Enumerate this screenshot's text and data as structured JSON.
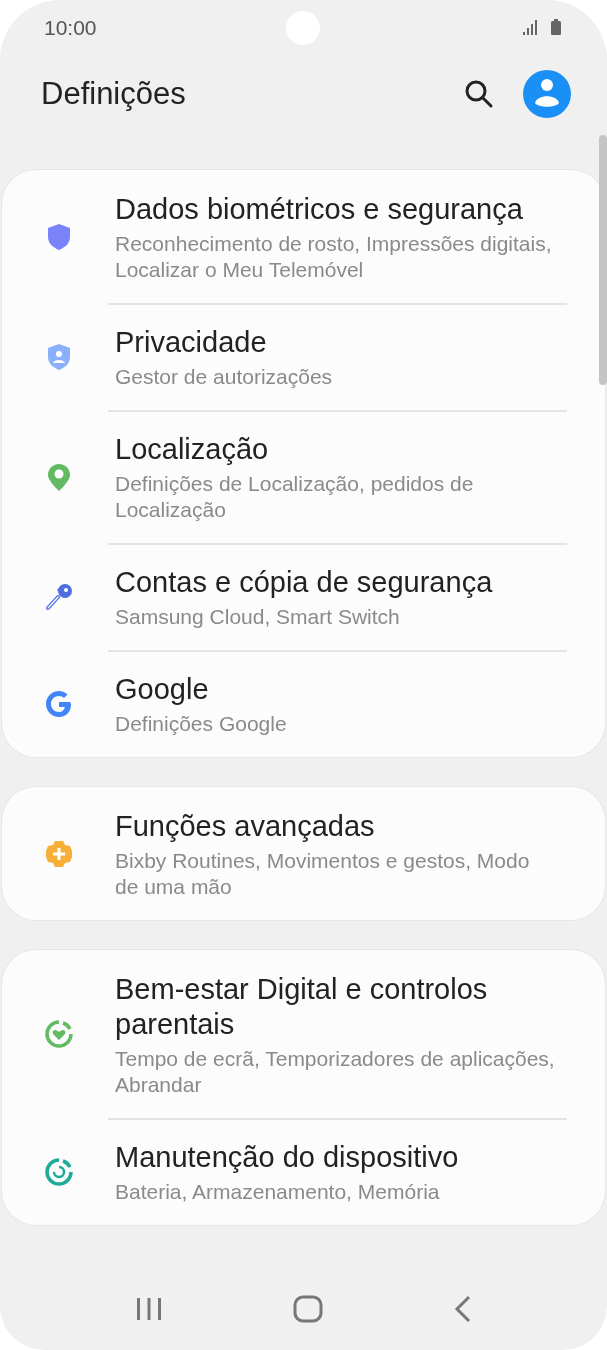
{
  "status_bar": {
    "time": "10:00"
  },
  "header": {
    "title": "Definições"
  },
  "groups": [
    {
      "items": [
        {
          "kind": "shield",
          "title": "Dados biométricos e segurança",
          "subtitle": "Reconhecimento de rosto, Impressões digitais, Localizar o Meu Telemóvel"
        },
        {
          "kind": "privacy",
          "title": "Privacidade",
          "subtitle": "Gestor de autorizações"
        },
        {
          "kind": "location",
          "title": "Localização",
          "subtitle": "Definições de Localização, pedidos de Localização"
        },
        {
          "kind": "key",
          "title": "Contas e cópia de segurança",
          "subtitle": "Samsung Cloud, Smart Switch"
        },
        {
          "kind": "google",
          "title": "Google",
          "subtitle": "Definições Google"
        }
      ]
    },
    {
      "items": [
        {
          "kind": "advanced",
          "title": "Funções avançadas",
          "subtitle": "Bixby Routines, Movimentos e gestos, Modo de uma mão"
        }
      ]
    },
    {
      "items": [
        {
          "kind": "wellbeing",
          "title": "Bem-estar Digital e controlos parentais",
          "subtitle": "Tempo de ecrã, Temporizadores de aplicações, Abrandar"
        },
        {
          "kind": "maintenance",
          "title": "Manutenção do dispositivo",
          "subtitle": "Bateria, Armazenamento, Memória"
        }
      ]
    }
  ]
}
